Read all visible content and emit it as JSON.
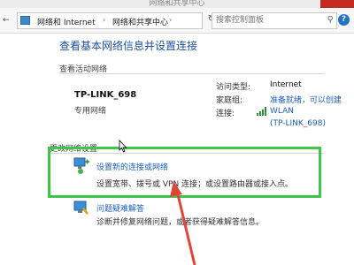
{
  "window": {
    "title": "网络和共享中心"
  },
  "address_bar": {
    "breadcrumbs": [
      "网络和 Internet",
      "网络和共享中心"
    ],
    "separator": "›",
    "search_placeholder": "搜索控制面板",
    "back_icon": "back-arrow-icon",
    "forward_icon": "forward-arrow-icon",
    "up_icon": "up-arrow-icon",
    "refresh_icon": "refresh-icon",
    "help_label": "?"
  },
  "main": {
    "title": "查看基本网络信息并设置连接",
    "active_networks_heading": "查看活动网络",
    "network": {
      "name": "TP-LINK_698",
      "type": "专用网络",
      "access_type_label": "访问类型:",
      "access_type_value": "Internet",
      "homegroup_label": "家庭组:",
      "homegroup_value": "准备就绪，可以创建",
      "connections_label": "连接:",
      "connection_value_line1": "WLAN",
      "connection_value_line2": "(TP-LINK_698)"
    },
    "change_settings_heading": "更改网络设置",
    "tasks": [
      {
        "title": "设置新的连接或网络",
        "description": "设置宽带、拨号或 VPN 连接；或设置路由器或接入点。",
        "icon": "network-setup-icon"
      },
      {
        "title": "问题疑难解答",
        "description": "诊断并修复网络问题，或者获得疑难解答信息。",
        "icon": "troubleshoot-icon"
      }
    ]
  },
  "colors": {
    "link": "#1e5fb4",
    "title": "#1e4f9c",
    "highlight": "#3ec64b",
    "annotation_arrow": "#e0453a",
    "close_button": "#c42b1c"
  }
}
